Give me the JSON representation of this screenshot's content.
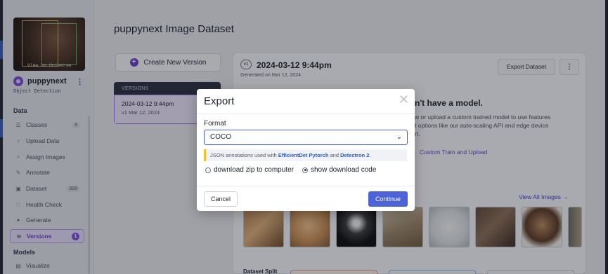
{
  "sidebar": {
    "thumbnail_caption": "View on Universe",
    "project_name": "puppynext",
    "project_menu": "⋮",
    "project_type": "Object Detection",
    "data_section": "Data",
    "models_section": "Models",
    "items": [
      {
        "label": "Classes",
        "icon": "list-icon",
        "glyph": "☰",
        "badge": "4"
      },
      {
        "label": "Upload Data",
        "icon": "upload-icon",
        "glyph": "↑",
        "badge": ""
      },
      {
        "label": "Assign Images",
        "icon": "search-icon",
        "glyph": "⌕",
        "badge": ""
      },
      {
        "label": "Annotate",
        "icon": "annotate-icon",
        "glyph": "✎",
        "badge": ""
      },
      {
        "label": "Dataset",
        "icon": "image-icon",
        "glyph": "▣",
        "badge": "999"
      },
      {
        "label": "Health Check",
        "icon": "health-icon",
        "glyph": "♡",
        "badge": ""
      },
      {
        "label": "Generate",
        "icon": "generate-icon",
        "glyph": "✦",
        "badge": ""
      },
      {
        "label": "Versions",
        "icon": "versions-icon",
        "glyph": "≋",
        "badge": "1",
        "active": true
      }
    ],
    "model_items": [
      {
        "label": "Visualize",
        "icon": "chart-icon",
        "glyph": "▤"
      }
    ]
  },
  "main": {
    "title": "puppynext Image Dataset",
    "create_version": "Create New Version",
    "versions_header": "VERSIONS",
    "version_card": {
      "title": "2024-03-12 9:44pm",
      "subtitle": "v1 Mar 12, 2024"
    },
    "detail": {
      "version_badge": "v1",
      "title": "2024-03-12 9:44pm",
      "generated": "Generated on Mar 12, 2024",
      "export_button": "Export Dataset",
      "more_button": "⋮",
      "no_model_heading": "n't have a model.",
      "body_lines": [
        "w or upload a custom trained model to use features",
        "t options like our auto-scaling API and edge device",
        "rt."
      ],
      "custom_link": "Custom Train and Upload",
      "view_all": "View All Images →",
      "dataset_split": "Dataset Split"
    }
  },
  "modal": {
    "title": "Export",
    "close": "✕",
    "format_label": "Format",
    "format_value": "COCO",
    "chevron": "⌄",
    "info_prefix": "JSON annotations used with ",
    "info_link1": "EfficientDet Pytorch",
    "info_mid": " and ",
    "info_link2": "Detectron 2",
    "info_suffix": ".",
    "option_zip": "download zip to computer",
    "option_code": "show download code",
    "selected_option": "show download code",
    "cancel": "Cancel",
    "continue": "Continue"
  },
  "colors": {
    "accent": "#6b3fd0",
    "primary_button": "#4b62d8",
    "info_border": "#f2c12e"
  }
}
